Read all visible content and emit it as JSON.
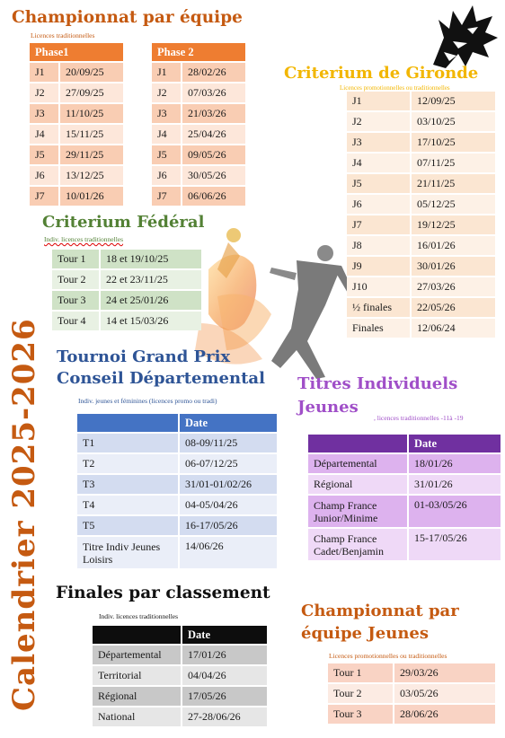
{
  "colors": {
    "orange": "#c55a11",
    "green": "#538135",
    "blue": "#2e5496",
    "purple": "#a04fc8",
    "gold": "#f2b600",
    "calendar": "#c55a11"
  },
  "calendar_label": "Calendrier 2025-2026",
  "championnat_equipe": {
    "title": "Championnat par équipe",
    "subtitle": "Licences traditionnelles",
    "phase1": {
      "header": "Phase1",
      "rows": [
        [
          "J1",
          "20/09/25"
        ],
        [
          "J2",
          "27/09/25"
        ],
        [
          "J3",
          "11/10/25"
        ],
        [
          "J4",
          "15/11/25"
        ],
        [
          "J5",
          "29/11/25"
        ],
        [
          "J6",
          "13/12/25"
        ],
        [
          "J7",
          "10/01/26"
        ]
      ]
    },
    "phase2": {
      "header": "Phase 2",
      "rows": [
        [
          "J1",
          "28/02/26"
        ],
        [
          "J2",
          "07/03/26"
        ],
        [
          "J3",
          "21/03/26"
        ],
        [
          "J4",
          "25/04/26"
        ],
        [
          "J5",
          "09/05/26"
        ],
        [
          "J6",
          "30/05/26"
        ],
        [
          "J7",
          "06/06/26"
        ]
      ]
    }
  },
  "criterium_gironde": {
    "title": "Criterium de Gironde",
    "subtitle": "Licences promotionnelles ou traditionnelles",
    "rows": [
      [
        "J1",
        "12/09/25"
      ],
      [
        "J2",
        "03/10/25"
      ],
      [
        "J3",
        "17/10/25"
      ],
      [
        "J4",
        "07/11/25"
      ],
      [
        "J5",
        "21/11/25"
      ],
      [
        "J6",
        "05/12/25"
      ],
      [
        "J7",
        "19/12/25"
      ],
      [
        "J8",
        "16/01/26"
      ],
      [
        "J9",
        "30/01/26"
      ],
      [
        "J10",
        "27/03/26"
      ],
      [
        "½ finales",
        "22/05/26"
      ],
      [
        "Finales",
        "12/06/24"
      ]
    ]
  },
  "criterium_federal": {
    "title": "Criterium Fédéral",
    "subtitle": "Indiv. licences traditionnelles",
    "rows": [
      [
        "Tour 1",
        "18 et 19/10/25"
      ],
      [
        "Tour 2",
        "22 et 23/11/25"
      ],
      [
        "Tour 3",
        "24 et 25/01/26"
      ],
      [
        "Tour 4",
        "14 et 15/03/26"
      ]
    ]
  },
  "tournoi": {
    "title_line1": "Tournoi Grand Prix",
    "title_line2": "Conseil Départemental",
    "subtitle": "Indiv. jeunes et féminines (licences promo ou tradi)",
    "header": "Date",
    "rows": [
      [
        "T1",
        "08-09/11/25"
      ],
      [
        "T2",
        "06-07/12/25"
      ],
      [
        "T3",
        "31/01-01/02/26"
      ],
      [
        "T4",
        "04-05/04/26"
      ],
      [
        "T5",
        "16-17/05/26"
      ],
      [
        "Titre Indiv Jeunes Loisirs",
        "14/06/26"
      ]
    ]
  },
  "titres_jeunes": {
    "title_line1": "Titres Individuels",
    "title_line2": "Jeunes",
    "subtitle": ", licences traditionnelles -11à -19",
    "header": "Date",
    "rows": [
      [
        "Départemental",
        "18/01/26"
      ],
      [
        "Régional",
        "31/01/26"
      ],
      [
        "Champ France Junior/Minime",
        "01-03/05/26"
      ],
      [
        "Champ France Cadet/Benjamin",
        "15-17/05/26"
      ]
    ]
  },
  "finales_classement": {
    "title": "Finales par classement",
    "subtitle": "Indiv. licences traditionnelles",
    "header": "Date",
    "rows": [
      [
        "Départemental",
        "17/01/26"
      ],
      [
        "Territorial",
        "04/04/26"
      ],
      [
        "Régional",
        "17/05/26"
      ],
      [
        "National",
        "27-28/06/26"
      ]
    ]
  },
  "championnat_jeunes": {
    "title_line1": "Championnat par",
    "title_line2": "équipe Jeunes",
    "subtitle": "Licences promotionnelles ou traditionnelles",
    "rows": [
      [
        "Tour 1",
        "29/03/26"
      ],
      [
        "Tour 2",
        "03/05/26"
      ],
      [
        "Tour 3",
        "28/06/26"
      ]
    ]
  }
}
